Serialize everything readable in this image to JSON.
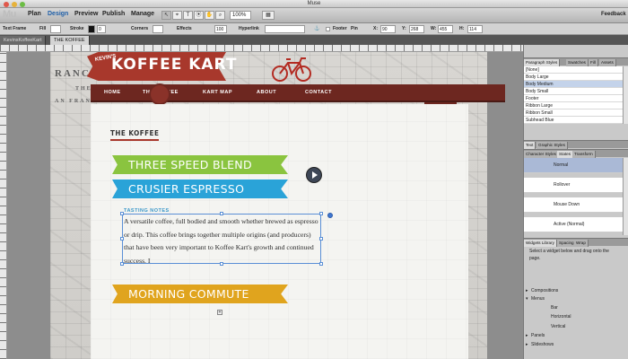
{
  "window": {
    "title": "Muse"
  },
  "menubar": {
    "logo": "Mu",
    "modes": [
      "Plan",
      "Design",
      "Preview",
      "Publish",
      "Manage"
    ],
    "zoom": "100%",
    "feedback": "Feedback",
    "tools": [
      "↖",
      "⌖",
      "T",
      "⦿",
      "✋",
      "⌕"
    ]
  },
  "optionsbar": {
    "text_frame": "Text Frame",
    "fill": "Fill",
    "stroke": "Stroke",
    "stroke_value": "0",
    "corners": "Corners",
    "effects": "Effects",
    "opacity": "100",
    "hyperlink": "Hyperlink",
    "footer": "Footer",
    "pin": "Pin",
    "x_label": "X:",
    "x_value": "90",
    "y_label": "Y:",
    "y_value": "268",
    "w_label": "W:",
    "w_value": "455",
    "h_label": "H:",
    "h_value": "114"
  },
  "tabs": [
    "KevinsKoffeeKart",
    "THE KOFFEE"
  ],
  "site": {
    "logo_small": "KEVIN'S",
    "logo": "KOFFEE KART",
    "nav": [
      "HOME",
      "THE KOFFEE",
      "KART MAP",
      "ABOUT",
      "CONTACT"
    ],
    "map_words": [
      "RANCIS",
      "THE",
      "AN FRANCIS"
    ],
    "heading": "THE KOFFEE",
    "ribbons": [
      "THREE SPEED BLEND",
      "CRUSIER ESPRESSO",
      "MORNING COMMUTE"
    ],
    "tasting_label": "TASTING NOTES",
    "body": "A versatile coffee, full bodied and smooth whether brewed as espresso or drip. This coffee brings together multiple origins (and producers) that have been very important to Koffee Kart's  growth and continued success. I",
    "colors": {
      "banner_red": "#a8382c",
      "nav_brown": "#6d2720",
      "green": "#8ac43f",
      "blue": "#2aa3d8",
      "gold": "#e0a41e"
    }
  },
  "panels": {
    "paragraph_tabs": [
      "Paragraph Styles",
      "Swatches",
      "Fill",
      "Assets"
    ],
    "paragraph_styles": [
      "[None]",
      "Body Large",
      "Body Medium",
      "Body Small",
      "Footer",
      "Ribbon Large",
      "Ribbon Small",
      "Subhead Blue"
    ],
    "selected_style": "Body Medium",
    "text_tabs": [
      "Text",
      "Graphic Styles"
    ],
    "state_tabs": [
      "Character Styles",
      "States",
      "Transform"
    ],
    "states": [
      "Normal",
      "Rollover",
      "Mouse Down",
      "Active (Normal)"
    ],
    "widget_tabs": [
      "Widgets Library",
      "Spacing",
      "Wrap"
    ],
    "widget_hint": "Select a widget below and drag onto the page.",
    "widget_items": [
      "Compositions",
      "Menus",
      "Bar",
      "Horizontal",
      "Vertical",
      "Panels",
      "Slideshows"
    ]
  }
}
